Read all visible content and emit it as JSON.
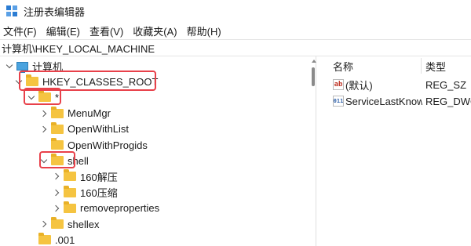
{
  "window": {
    "title": "注册表编辑器"
  },
  "menu": [
    "文件(F)",
    "编辑(E)",
    "查看(V)",
    "收藏夹(A)",
    "帮助(H)"
  ],
  "address": "计算机\\HKEY_LOCAL_MACHINE",
  "tree": [
    {
      "label": "计算机",
      "icon": "computer-icon",
      "indent": 6,
      "expander": "open"
    },
    {
      "label": "HKEY_CLASSES_ROOT",
      "icon": "folder-icon",
      "indent": 18,
      "expander": "open"
    },
    {
      "label": "*",
      "icon": "folder-icon",
      "indent": 34,
      "expander": "open"
    },
    {
      "label": "MenuMgr",
      "icon": "folder-icon",
      "indent": 50,
      "expander": "chev"
    },
    {
      "label": "OpenWithList",
      "icon": "folder-icon",
      "indent": 50,
      "expander": "chev"
    },
    {
      "label": "OpenWithProgids",
      "icon": "folder-icon",
      "indent": 50,
      "expander": "none"
    },
    {
      "label": "shell",
      "icon": "folder-icon",
      "indent": 50,
      "expander": "open"
    },
    {
      "label": "160解压",
      "icon": "folder-icon",
      "indent": 66,
      "expander": "chev"
    },
    {
      "label": "160压缩",
      "icon": "folder-icon",
      "indent": 66,
      "expander": "chev"
    },
    {
      "label": "removeproperties",
      "icon": "folder-icon",
      "indent": 66,
      "expander": "chev"
    },
    {
      "label": "shellex",
      "icon": "folder-icon",
      "indent": 50,
      "expander": "chev"
    },
    {
      "label": ".001",
      "icon": "folder-icon",
      "indent": 34,
      "expander": "none"
    }
  ],
  "list": {
    "headers": {
      "name": "名称",
      "type": "类型"
    },
    "rows": [
      {
        "icon": "string-value-icon",
        "icon_text": "ab",
        "name": "(默认)",
        "type": "REG_SZ"
      },
      {
        "icon": "binary-value-icon",
        "icon_text": "011",
        "name": "ServiceLastKnownStatus",
        "type": "REG_DWORD"
      }
    ]
  },
  "highlight_color": "#e8414a"
}
